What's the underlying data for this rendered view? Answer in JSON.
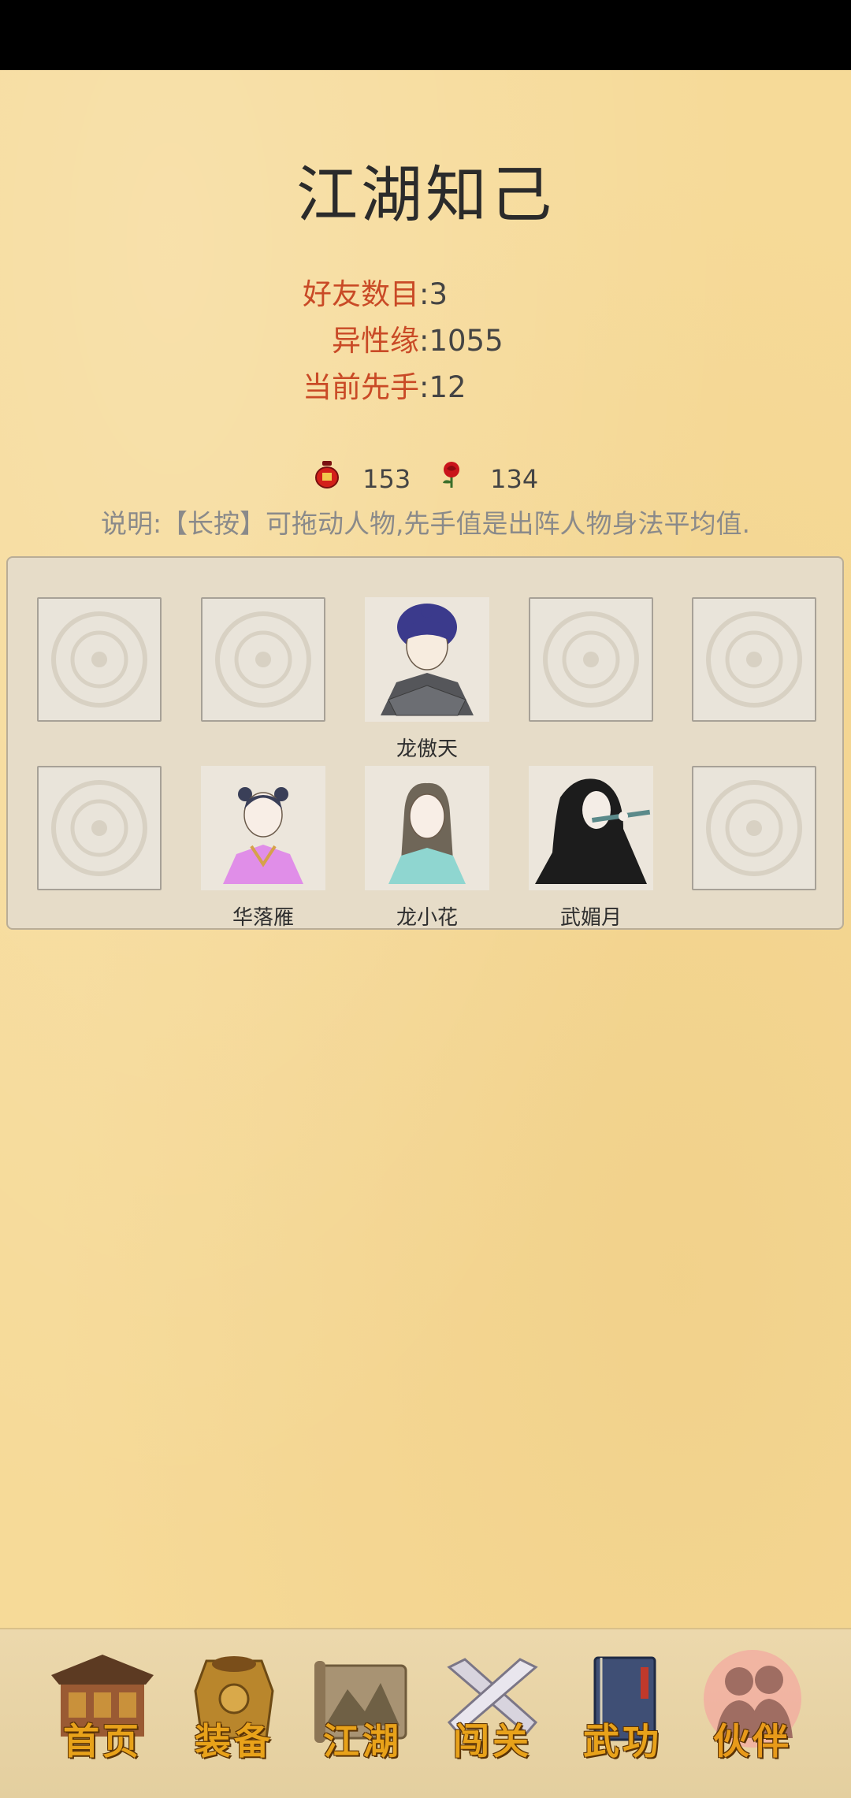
{
  "page": {
    "title": "江湖知己"
  },
  "stats": [
    {
      "label": "好友数目",
      "value": ":3"
    },
    {
      "label": "异性缘",
      "value": ":1055"
    },
    {
      "label": "当前先手",
      "value": ":12"
    }
  ],
  "currency": {
    "jar_count": "153",
    "rose_count": "134"
  },
  "note": "说明:【长按】可拖动人物,先手值是出阵人物身法平均值.",
  "formation": {
    "row1": [
      "",
      "",
      "龙傲天",
      "",
      ""
    ],
    "row2": [
      "",
      "华落雁",
      "龙小花",
      "武媚月",
      ""
    ]
  },
  "nav": {
    "items": [
      {
        "label": "首页",
        "icon": "house-icon"
      },
      {
        "label": "装备",
        "icon": "armor-icon"
      },
      {
        "label": "江湖",
        "icon": "scroll-map-icon"
      },
      {
        "label": "闯关",
        "icon": "swords-icon"
      },
      {
        "label": "武功",
        "icon": "book-icon"
      },
      {
        "label": "伙伴",
        "icon": "partners-icon"
      }
    ],
    "active": "伙伴"
  },
  "colors": {
    "label_red": "#c94a26",
    "value_gray": "#444444",
    "note_gray": "#8a8a8a",
    "nav_gold": "#e8a21a",
    "panel_bg": "#e6dcc8"
  }
}
